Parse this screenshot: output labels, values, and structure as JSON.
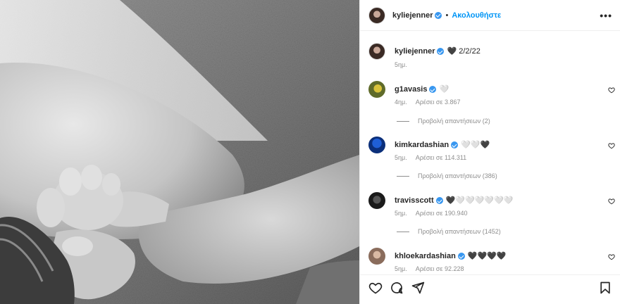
{
  "header": {
    "username": "kyliejenner",
    "follow_label": "Ακολουθήστε",
    "separator": "•",
    "more_label": "•••"
  },
  "caption": {
    "username": "kyliejenner",
    "text": "🖤 2/2/22",
    "time": "5ημ."
  },
  "comments": [
    {
      "username": "g1avasis",
      "text": "🤍",
      "time": "4ημ.",
      "likes": "Αρέσει σε 3.867",
      "replies": "Προβολή απαντήσεων (2)"
    },
    {
      "username": "kimkardashian",
      "text": "🤍🤍🖤",
      "time": "5ημ.",
      "likes": "Αρέσει σε 114.311",
      "replies": "Προβολή απαντήσεων (386)"
    },
    {
      "username": "travisscott",
      "text": "🖤🤍🤍🤍🤍🤍🤍",
      "time": "5ημ.",
      "likes": "Αρέσει σε 190.940",
      "replies": "Προβολή απαντήσεων (1452)"
    },
    {
      "username": "khloekardashian",
      "text": "🖤🖤🖤🖤",
      "time": "5ημ.",
      "likes": "Αρέσει σε 92.228",
      "replies": ""
    }
  ],
  "icons": {
    "more": "more-options-icon",
    "like": "heart-icon",
    "comment": "comment-icon",
    "share": "share-icon",
    "save": "bookmark-icon",
    "verified": "verified-badge-icon"
  },
  "colors": {
    "accent": "#0095f6",
    "verified": "#3897f0",
    "muted": "#8e8e8e",
    "text": "#262626"
  }
}
